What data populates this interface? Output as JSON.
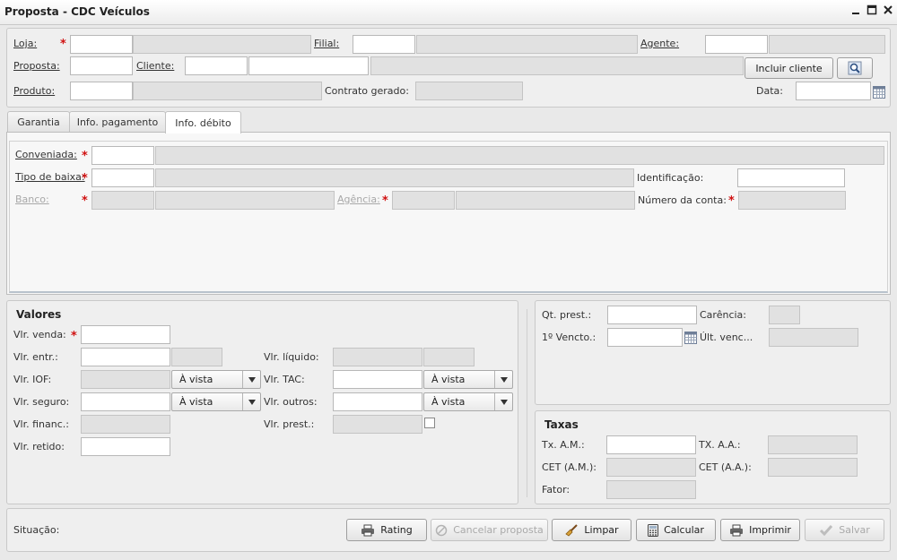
{
  "window": {
    "title": "Proposta - CDC Veículos"
  },
  "header": {
    "loja_label": "Loja:",
    "filial_label": "Filial:",
    "agente_label": "Agente:",
    "proposta_label": "Proposta:",
    "cliente_label": "Cliente:",
    "incluir_cliente": "Incluir cliente",
    "produto_label": "Produto:",
    "contrato_label": "Contrato gerado:",
    "data_label": "Data:"
  },
  "tabs": [
    "Garantia",
    "Info. pagamento",
    "Info. débito"
  ],
  "debito": {
    "conveniada_label": "Conveniada:",
    "tipo_baixa_label": "Tipo de baixa:",
    "identificacao_label": "Identificação:",
    "banco_label": "Banco:",
    "agencia_label": "Agência:",
    "numero_conta_label": "Número da conta:"
  },
  "valores": {
    "title": "Valores",
    "venda": "Vlr. venda:",
    "entr": "Vlr. entr.:",
    "iof": "Vlr. IOF:",
    "seguro": "Vlr. seguro:",
    "financ": "Vlr. financ.:",
    "retido": "Vlr. retido:",
    "liquido": "Vlr. líquido:",
    "tac": "Vlr. TAC:",
    "outros": "Vlr. outros:",
    "prest": "Vlr. prest.:",
    "a_vista": "À vista"
  },
  "prestacoes": {
    "qt_prest": "Qt. prest.:",
    "carencia": "Carência:",
    "primeiro_vencto": "1º Vencto.:",
    "ult_venc": "Últ. venc..."
  },
  "taxas": {
    "title": "Taxas",
    "tx_am": "Tx. A.M.:",
    "tx_aa": "TX. A.A.:",
    "cet_am": "CET (A.M.):",
    "cet_aa": "CET (A.A.):",
    "fator": "Fator:"
  },
  "footer": {
    "situacao": "Situação:",
    "rating": "Rating",
    "cancelar": "Cancelar proposta",
    "limpar": "Limpar",
    "calcular": "Calcular",
    "imprimir": "Imprimir",
    "salvar": "Salvar"
  }
}
